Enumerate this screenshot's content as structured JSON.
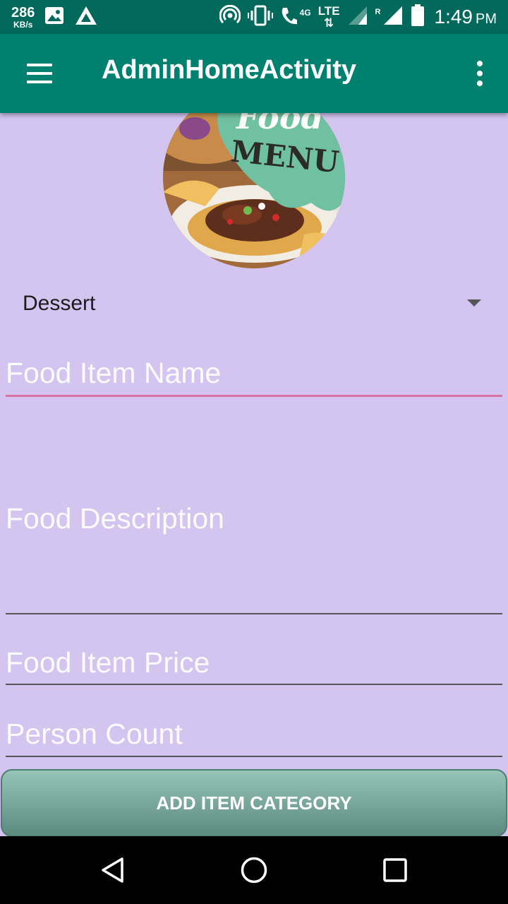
{
  "status_bar": {
    "net_speed_value": "286",
    "net_speed_unit": "KB/s",
    "network_4g": "4G",
    "network_lte": "LTE",
    "roaming": "R",
    "time": "1:49",
    "ampm": "PM"
  },
  "app_bar": {
    "title": "AdminHomeActivity"
  },
  "image": {
    "sign_text_top": "Food",
    "sign_text_bottom": "MENU"
  },
  "spinner": {
    "selected": "Dessert"
  },
  "form": {
    "name_placeholder": "Food Item Name",
    "description_placeholder": "Food Description",
    "price_placeholder": "Food Item Price",
    "count_placeholder": "Person Count"
  },
  "button": {
    "label": "ADD ITEM CATEGORY"
  },
  "colors": {
    "status_bar": "#00695c",
    "app_bar": "#00806f",
    "background": "#d3c5ef",
    "focused_underline": "#d6759f"
  },
  "icons": [
    "photo-icon",
    "drive-icon",
    "hotspot-icon",
    "vibrate-icon",
    "wifi-calling-icon",
    "signal-icon",
    "battery-icon",
    "menu-icon",
    "overflow-icon",
    "back-icon",
    "home-icon",
    "recents-icon"
  ]
}
